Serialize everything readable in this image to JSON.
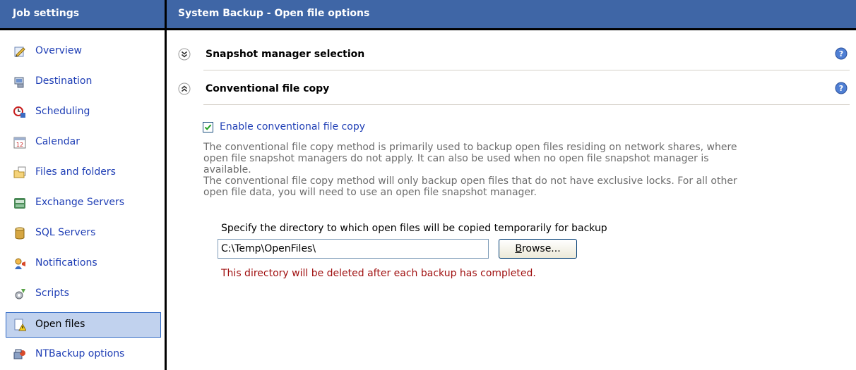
{
  "sidebar": {
    "title": "Job settings",
    "items": [
      {
        "label": "Overview",
        "icon": "overview-icon"
      },
      {
        "label": "Destination",
        "icon": "destination-icon"
      },
      {
        "label": "Scheduling",
        "icon": "scheduling-icon"
      },
      {
        "label": "Calendar",
        "icon": "calendar-icon"
      },
      {
        "label": "Files and folders",
        "icon": "folder-icon"
      },
      {
        "label": "Exchange Servers",
        "icon": "exchange-icon"
      },
      {
        "label": "SQL Servers",
        "icon": "database-icon"
      },
      {
        "label": "Notifications",
        "icon": "notifications-icon"
      },
      {
        "label": "Scripts",
        "icon": "scripts-icon"
      },
      {
        "label": "Open files",
        "icon": "open-files-icon",
        "selected": true
      },
      {
        "label": "NTBackup options",
        "icon": "ntbackup-icon"
      }
    ]
  },
  "header": {
    "title": "System Backup - Open file options"
  },
  "sections": [
    {
      "title": "Snapshot manager selection",
      "expanded": false
    },
    {
      "title": "Conventional file copy",
      "expanded": true
    }
  ],
  "conventional": {
    "checkbox_label": "Enable conventional file copy",
    "checked": true,
    "desc_line1": "The conventional file copy method is primarily used to backup open files residing on network shares, where open file snapshot managers do not apply. It can also be used when no open file snapshot manager is available.",
    "desc_line2": "The conventional file copy method will only backup open files that do not have exclusive locks. For all other open file data, you will need to use an open file snapshot manager.",
    "dir_label": "Specify the directory to which open files will be copied temporarily for backup",
    "dir_value": "C:\\Temp\\OpenFiles\\",
    "browse_label": "Browse...",
    "warning": "This directory will be deleted after each backup has completed."
  },
  "colors": {
    "header_bg": "#3f66a6",
    "link_blue": "#2140b6",
    "warning_red": "#a01010",
    "selected_bg": "#c1d2ee"
  }
}
